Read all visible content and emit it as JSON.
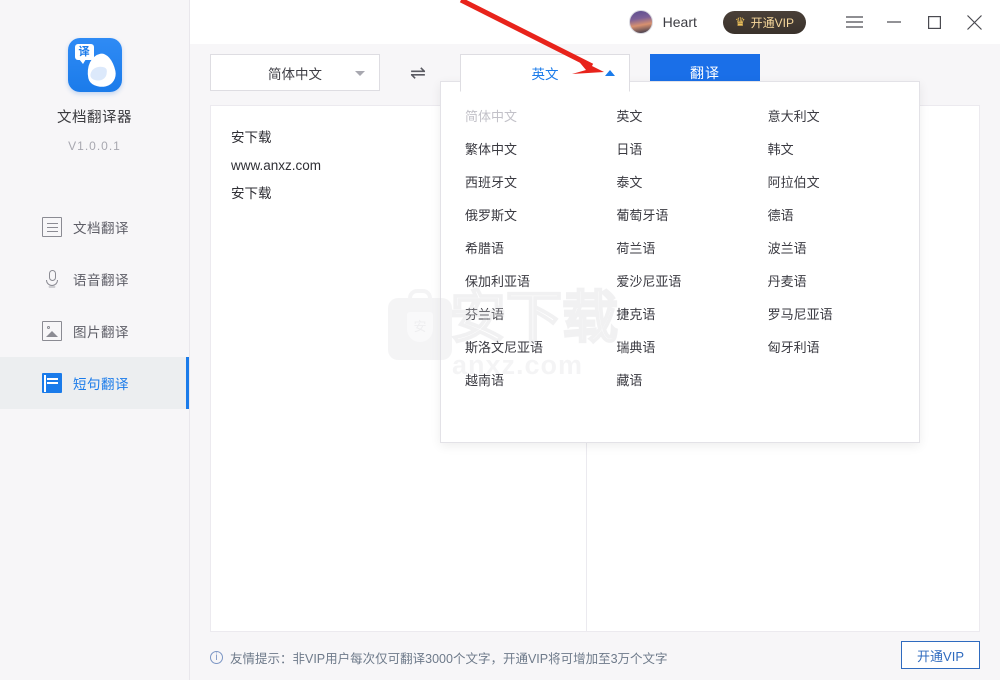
{
  "app": {
    "title": "文档翻译器",
    "version": "V1.0.0.1",
    "logo_badge": "译"
  },
  "sidebar": {
    "items": [
      {
        "label": "文档翻译",
        "icon": "document-icon",
        "active": false
      },
      {
        "label": "语音翻译",
        "icon": "microphone-icon",
        "active": false
      },
      {
        "label": "图片翻译",
        "icon": "image-icon",
        "active": false
      },
      {
        "label": "短句翻译",
        "icon": "sentence-icon",
        "active": true
      }
    ]
  },
  "header": {
    "username": "Heart",
    "vip_button": "开通VIP",
    "crown_icon": "♛",
    "menu_icon": "hamburger-icon",
    "minimize_icon": "minimize-icon",
    "maximize_icon": "maximize-icon",
    "close_icon": "close-icon"
  },
  "toolbar": {
    "source_language": "简体中文",
    "swap_icon": "⇌",
    "target_language": "英文",
    "translate_button": "翻译"
  },
  "language_dropdown": {
    "open": true,
    "columns": [
      [
        "简体中文",
        "繁体中文",
        "西班牙文",
        "俄罗斯文",
        "希腊语",
        "保加利亚语",
        "芬兰语",
        "斯洛文尼亚语",
        "越南语"
      ],
      [
        "英文",
        "日语",
        "泰文",
        "葡萄牙语",
        "荷兰语",
        "爱沙尼亚语",
        "捷克语",
        "瑞典语",
        "藏语"
      ],
      [
        "意大利文",
        "韩文",
        "阿拉伯文",
        "德语",
        "波兰语",
        "丹麦语",
        "罗马尼亚语",
        "匈牙利语"
      ]
    ],
    "disabled_option": "简体中文"
  },
  "editor": {
    "source_lines": [
      "安下载",
      "www.anxz.com",
      "安下载"
    ],
    "target_lines": []
  },
  "footer": {
    "tip_icon": "info-icon",
    "tip_text": "友情提示：非VIP用户每次仅可翻译3000个文字，开通VIP将可增加至3万个文字",
    "vip_button": "开通VIP"
  },
  "watermark": {
    "text": "安下载",
    "sub": "anxz.com"
  },
  "colors": {
    "accent": "#1a7bea",
    "translate_button": "#1a6fe8",
    "sidebar_bg": "#f7f6f8",
    "vip_gold": "#f6d79b",
    "annotation": "#e8231b"
  }
}
